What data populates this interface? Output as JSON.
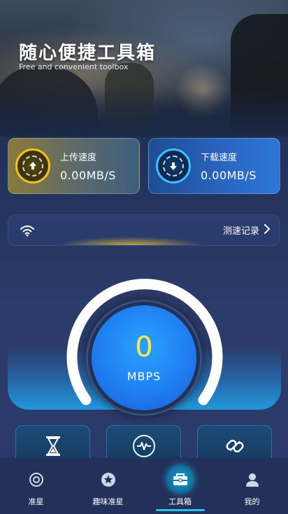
{
  "hero": {
    "title": "随心便捷工具箱",
    "subtitle": "Free and convenient toolbox"
  },
  "speed": {
    "upload_label": "上传速度",
    "upload_value": "0.00MB/S",
    "download_label": "下载速度",
    "download_value": "0.00MB/S"
  },
  "record": {
    "label": "测速记录",
    "wifi_icon": "wifi-icon",
    "chevron_icon": "chevron-right-icon"
  },
  "gauge": {
    "value": "0",
    "unit": "MBPS"
  },
  "tools": [
    {
      "icon": "hourglass-icon"
    },
    {
      "icon": "pulse-icon"
    },
    {
      "icon": "link-icon"
    }
  ],
  "nav": {
    "items": [
      {
        "label": "准星",
        "icon": "crosshair-icon",
        "active": false
      },
      {
        "label": "趣味准星",
        "icon": "star-icon",
        "active": false
      },
      {
        "label": "工具箱",
        "icon": "toolbox-icon",
        "active": true
      },
      {
        "label": "我的",
        "icon": "user-icon",
        "active": false
      }
    ]
  },
  "colors": {
    "accent": "#27c3ee",
    "gauge_value": "#ffe94a",
    "upload_ring": "#f2c21b",
    "download_ring": "#3fc0ff"
  }
}
